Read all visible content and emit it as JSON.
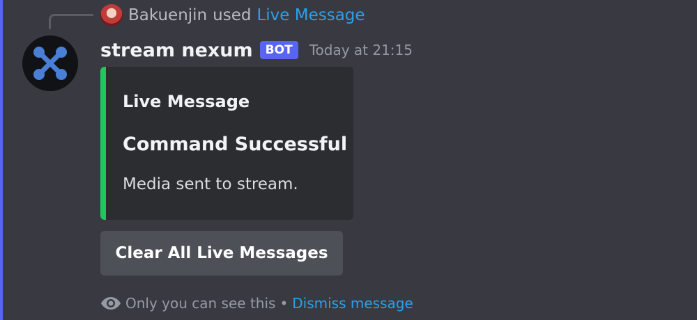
{
  "reply": {
    "username": "Bakuenjin",
    "used_text": "used",
    "command_name": "Live Message"
  },
  "message": {
    "author": "stream nexum",
    "bot_tag": "BOT",
    "timestamp": "Today at 21:15"
  },
  "embed": {
    "author": "Live Message",
    "title": "Command Successful",
    "description": "Media sent to stream.",
    "accent_color": "#23c55e"
  },
  "button": {
    "label": "Clear All Live Messages"
  },
  "ephemeral": {
    "notice": "Only you can see this",
    "separator": "•",
    "dismiss_label": "Dismiss message"
  },
  "colors": {
    "background": "#393a41",
    "highlight": "#5865f2",
    "link": "#2aa0ea",
    "embed_background": "#2b2d31",
    "button_background": "#4e5058"
  },
  "icons": {
    "avatar": "nexum-logo-icon",
    "ephemeral": "eye-icon"
  }
}
